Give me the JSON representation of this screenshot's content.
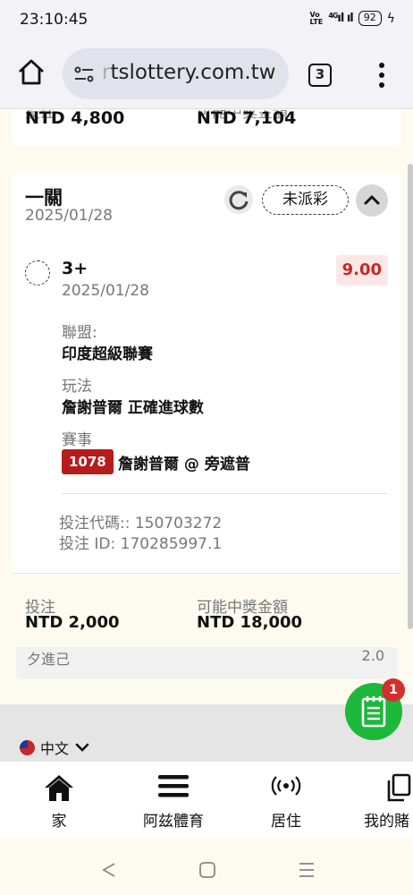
{
  "status_bar": {
    "time": "23:10:45",
    "network": "4G",
    "battery": "92"
  },
  "browser": {
    "url_faded": "r",
    "url": "tslottery.com.tw",
    "tab_count": "3"
  },
  "prev_card": {
    "label_left": "投注",
    "label_right": "可能中獎金額",
    "stake": "NTD 4,800",
    "payout": "NTD 7,104"
  },
  "bet": {
    "leg_title": "一關",
    "leg_date": "2025/01/28",
    "status": "未派彩",
    "selection": "3+",
    "selection_date": "2025/01/28",
    "odds": "9.00",
    "league_label": "聯盟:",
    "league": "印度超級聯賽",
    "market_label": "玩法",
    "market": "詹謝普爾 正確進球數",
    "event_label": "賽事",
    "event_code": "1078",
    "event_name": "詹謝普爾 @ 旁遮普",
    "bet_code": "投注代碼:: 150703272",
    "bet_id": "投注 ID: 170285997.1",
    "stake_label": "投注",
    "stake": "NTD 2,000",
    "payout_label": "可能中獎金額",
    "payout": "NTD 18,000"
  },
  "under_card": {
    "left": "夕進己",
    "right": "2.0"
  },
  "language": "中文",
  "fab_badge": "1",
  "nav": [
    {
      "label": "家",
      "icon": "home-icon"
    },
    {
      "label": "阿兹體育",
      "icon": "menu-icon"
    },
    {
      "label": "居住",
      "icon": "live-icon"
    },
    {
      "label": "我的賭",
      "icon": "copy-icon"
    }
  ],
  "colors": {
    "accent_green": "#1db83a",
    "badge_red": "#b71c1c",
    "odds_red": "#c62828",
    "page_bg": "#fdfaf0"
  }
}
